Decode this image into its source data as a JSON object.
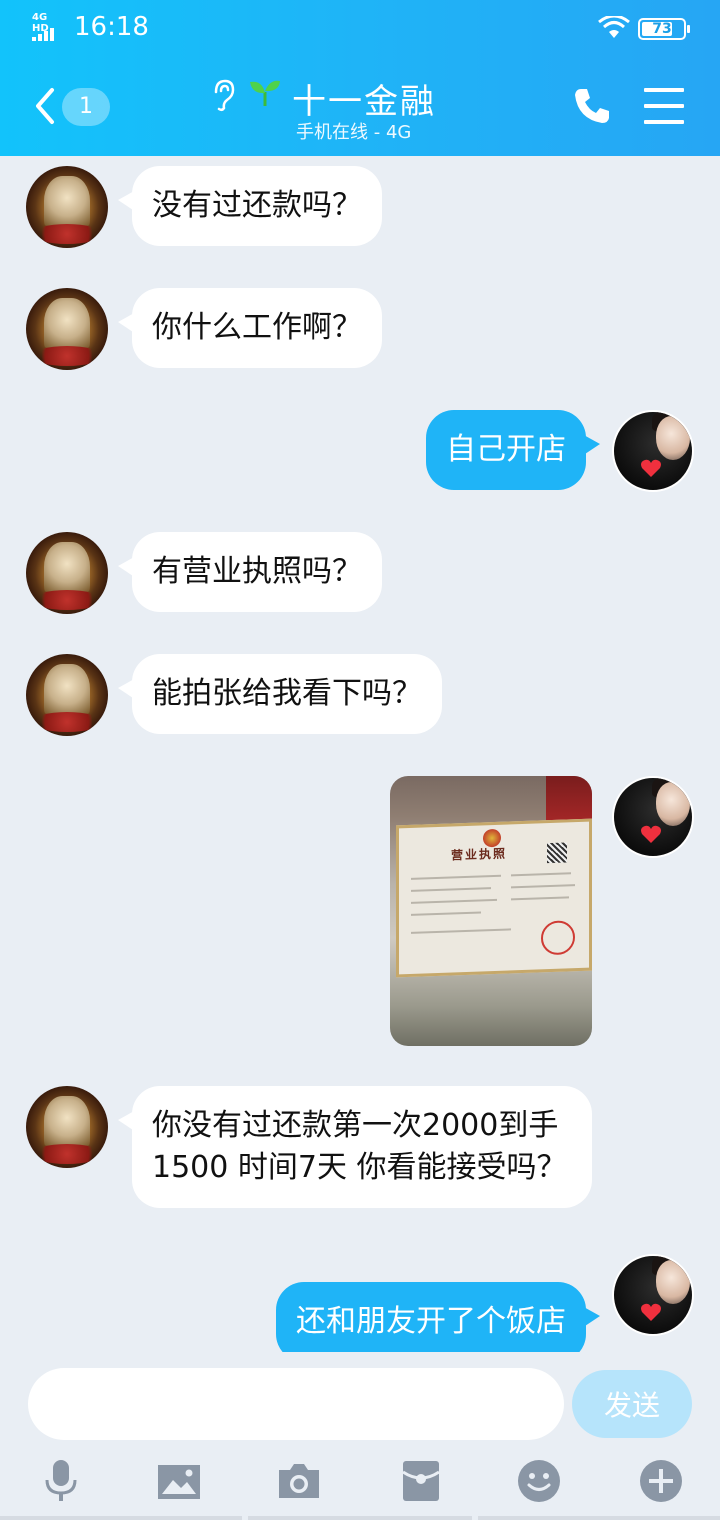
{
  "status_bar": {
    "network": "4G HD",
    "time": "16:18",
    "battery": "73"
  },
  "header": {
    "unread_count": "1",
    "contact_name": "十一金融",
    "contact_status": "手机在线 - 4G",
    "accent_color": "#1fb4f7"
  },
  "messages": [
    {
      "side": "left",
      "text": "没有过还款吗？"
    },
    {
      "side": "left",
      "text": "你什么工作啊？"
    },
    {
      "side": "right",
      "text": "自己开店"
    },
    {
      "side": "left",
      "text": "有营业执照吗？"
    },
    {
      "side": "left",
      "text": "能拍张给我看下吗？"
    },
    {
      "side": "right",
      "type": "image",
      "image_text": "营业执照"
    },
    {
      "side": "left",
      "text": "你没有过还款第一次2000到手1500 时间7天 你看能接受吗？"
    },
    {
      "side": "right",
      "text": "还和朋友开了个饭店"
    }
  ],
  "input": {
    "placeholder": "",
    "send_label": "发送"
  },
  "toolbar": {
    "icons": [
      "microphone-icon",
      "image-icon",
      "camera-icon",
      "red-packet-icon",
      "emoji-icon",
      "plus-icon"
    ]
  }
}
